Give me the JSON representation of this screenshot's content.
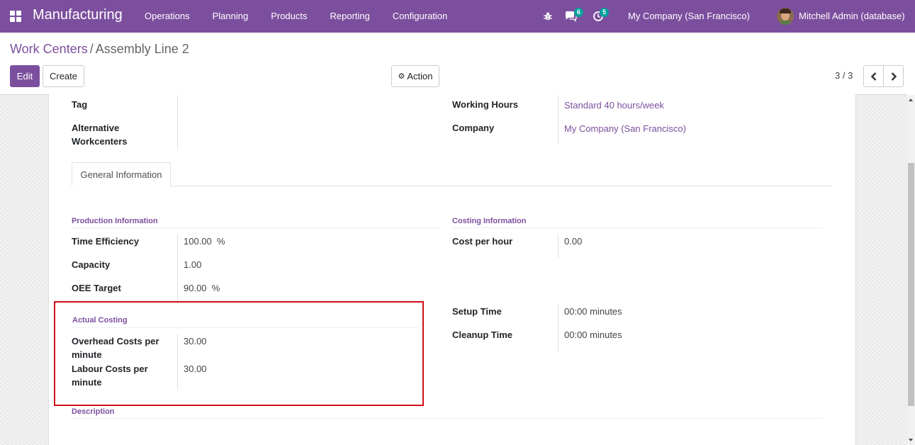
{
  "navbar": {
    "app_name": "Manufacturing",
    "menu": [
      "Operations",
      "Planning",
      "Products",
      "Reporting",
      "Configuration"
    ],
    "messages_count": "6",
    "activities_count": "5",
    "company": "My Company (San Francisco)",
    "user": "Mitchell Admin (database)"
  },
  "breadcrumb": {
    "parent": "Work Centers",
    "separator": "/",
    "current": "Assembly Line 2"
  },
  "buttons": {
    "edit": "Edit",
    "create": "Create",
    "action": "Action"
  },
  "pager": {
    "value": "3 / 3"
  },
  "form": {
    "tag_label": "Tag",
    "alt_label": "Alternative Workcenters",
    "working_hours_label": "Working Hours",
    "working_hours_value": "Standard 40 hours/week",
    "company_label": "Company",
    "company_value": "My Company (San Francisco)"
  },
  "tabs": [
    "General Information"
  ],
  "production": {
    "title": "Production Information",
    "time_efficiency_label": "Time Efficiency",
    "time_efficiency_value": "100.00",
    "time_efficiency_unit": "%",
    "capacity_label": "Capacity",
    "capacity_value": "1.00",
    "oee_label": "OEE Target",
    "oee_value": "90.00",
    "oee_unit": "%"
  },
  "costing": {
    "title": "Costing Information",
    "cost_label": "Cost per hour",
    "cost_value": "0.00",
    "setup_label": "Setup Time",
    "setup_value": "00:00 minutes",
    "cleanup_label": "Cleanup Time",
    "cleanup_value": "00:00 minutes"
  },
  "actual_costing": {
    "title": "Actual Costing",
    "overhead_label": "Overhead Costs per minute",
    "overhead_value": "30.00",
    "labour_label": "Labour Costs per minute",
    "labour_value": "30.00"
  },
  "description": {
    "title": "Description"
  },
  "colors": {
    "brand": "#7c4f9e",
    "badge": "#00a09d",
    "highlight": "#d0101a"
  }
}
